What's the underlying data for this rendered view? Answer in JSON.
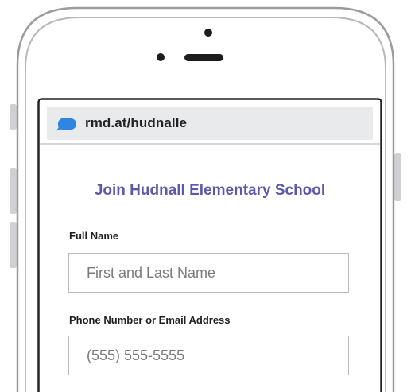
{
  "url_bar": {
    "icon": "chat-bubble-icon",
    "text": "rmd.at/hudnalle"
  },
  "form": {
    "title": "Join Hudnall Elementary School",
    "full_name": {
      "label": "Full Name",
      "placeholder": "First and Last Name",
      "value": ""
    },
    "contact": {
      "label": "Phone Number or Email Address",
      "placeholder": "(555) 555-5555",
      "value": ""
    }
  },
  "colors": {
    "accent": "#5c5aa8",
    "bubble": "#2f86e0",
    "phone_outline": "#9a9b9e",
    "url_bar_bg": "#e9eaec"
  }
}
